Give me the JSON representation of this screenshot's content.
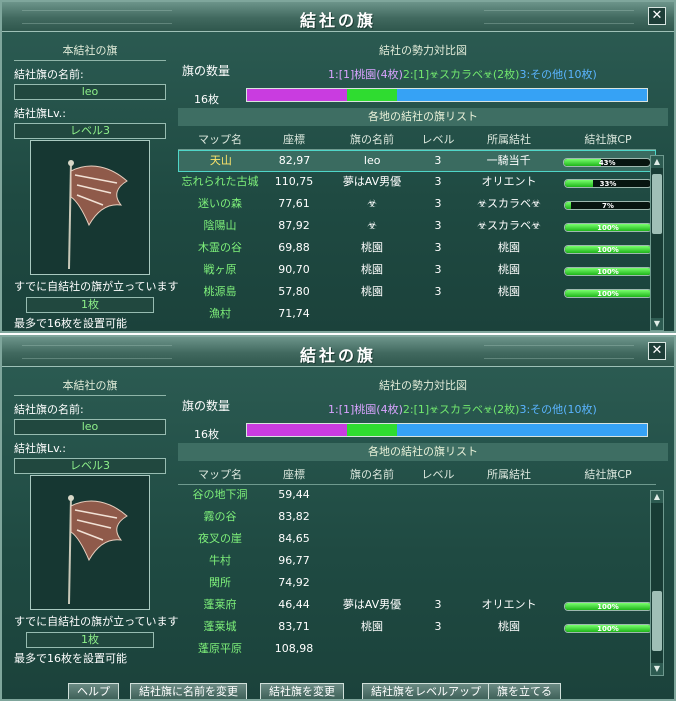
{
  "window_title": "結社の旗",
  "close_glyph": "✕",
  "left": {
    "section_title": "本結社の旗",
    "flag_name_label": "結社旗の名前:",
    "flag_name_value": "leo",
    "flag_level_label": "結社旗Lv.:",
    "flag_level_value": "レベル3",
    "notice_placed": "すでに自結社の旗が立っています",
    "placed_count": "1枚",
    "max_info": "最多で16枚を設置可能"
  },
  "right": {
    "section_title": "結社の勢力対比図",
    "flag_count_label": "旗の数量",
    "legend_1": "1:[1]桃園(4枚)",
    "legend_2": "2:[1]☣スカラベ☣(2枚)",
    "legend_3": "3:その他(10枚)",
    "total_count": "16枚",
    "ratio": [
      {
        "name": "桃園",
        "value": 4,
        "color": "#c93ce0"
      },
      {
        "name": "スカラベ",
        "value": 2,
        "color": "#2fdc30"
      },
      {
        "name": "その他",
        "value": 10,
        "color": "#36a2f5"
      }
    ],
    "list_title": "各地の結社の旗リスト",
    "columns": [
      "マップ名",
      "座標",
      "旗の名前",
      "レベル",
      "所属結社",
      "結社旗CP"
    ]
  },
  "rows_top": [
    {
      "map": "天山",
      "coord": "82,97",
      "flag": "leo",
      "level": "3",
      "guild": "一騎当千",
      "cp_label": "43%",
      "cp": 0.43,
      "selected": true
    },
    {
      "map": "忘れられた古城",
      "coord": "110,75",
      "flag": "夢はAV男優",
      "level": "3",
      "guild": "オリエント",
      "cp_label": "33%",
      "cp": 0.33
    },
    {
      "map": "迷いの森",
      "coord": "77,61",
      "flag": "☣",
      "level": "3",
      "guild": "☣スカラベ☣",
      "cp_label": "7%",
      "cp": 0.07
    },
    {
      "map": "陰陽山",
      "coord": "87,92",
      "flag": "☣",
      "level": "3",
      "guild": "☣スカラベ☣",
      "cp_label": "100%",
      "cp": 1.0
    },
    {
      "map": "木霊の谷",
      "coord": "69,88",
      "flag": "桃園",
      "level": "3",
      "guild": "桃園",
      "cp_label": "100%",
      "cp": 1.0
    },
    {
      "map": "戦ヶ原",
      "coord": "90,70",
      "flag": "桃園",
      "level": "3",
      "guild": "桃園",
      "cp_label": "100%",
      "cp": 1.0
    },
    {
      "map": "桃源島",
      "coord": "57,80",
      "flag": "桃園",
      "level": "3",
      "guild": "桃園",
      "cp_label": "100%",
      "cp": 1.0
    },
    {
      "map": "漁村",
      "coord": "71,74",
      "flag": "",
      "level": "",
      "guild": "",
      "cp_label": "",
      "cp": null
    }
  ],
  "rows_bottom": [
    {
      "map": "谷の地下洞",
      "coord": "59,44",
      "flag": "",
      "level": "",
      "guild": "",
      "cp_label": "",
      "cp": null
    },
    {
      "map": "霧の谷",
      "coord": "83,82",
      "flag": "",
      "level": "",
      "guild": "",
      "cp_label": "",
      "cp": null
    },
    {
      "map": "夜叉の崖",
      "coord": "84,65",
      "flag": "",
      "level": "",
      "guild": "",
      "cp_label": "",
      "cp": null
    },
    {
      "map": "牛村",
      "coord": "96,77",
      "flag": "",
      "level": "",
      "guild": "",
      "cp_label": "",
      "cp": null
    },
    {
      "map": "関所",
      "coord": "74,92",
      "flag": "",
      "level": "",
      "guild": "",
      "cp_label": "",
      "cp": null
    },
    {
      "map": "蓬莱府",
      "coord": "46,44",
      "flag": "夢はAV男優",
      "level": "3",
      "guild": "オリエント",
      "cp_label": "100%",
      "cp": 1.0
    },
    {
      "map": "蓬莱城",
      "coord": "83,71",
      "flag": "桃園",
      "level": "3",
      "guild": "桃園",
      "cp_label": "100%",
      "cp": 1.0
    },
    {
      "map": "蓬原平原",
      "coord": "108,98",
      "flag": "",
      "level": "",
      "guild": "",
      "cp_label": "",
      "cp": null
    }
  ],
  "buttons": {
    "help": "ヘルプ",
    "rename": "結社旗に名前を変更",
    "change": "結社旗を変更",
    "levelup": "結社旗をレベルアップ",
    "raise": "旗を立てる"
  }
}
